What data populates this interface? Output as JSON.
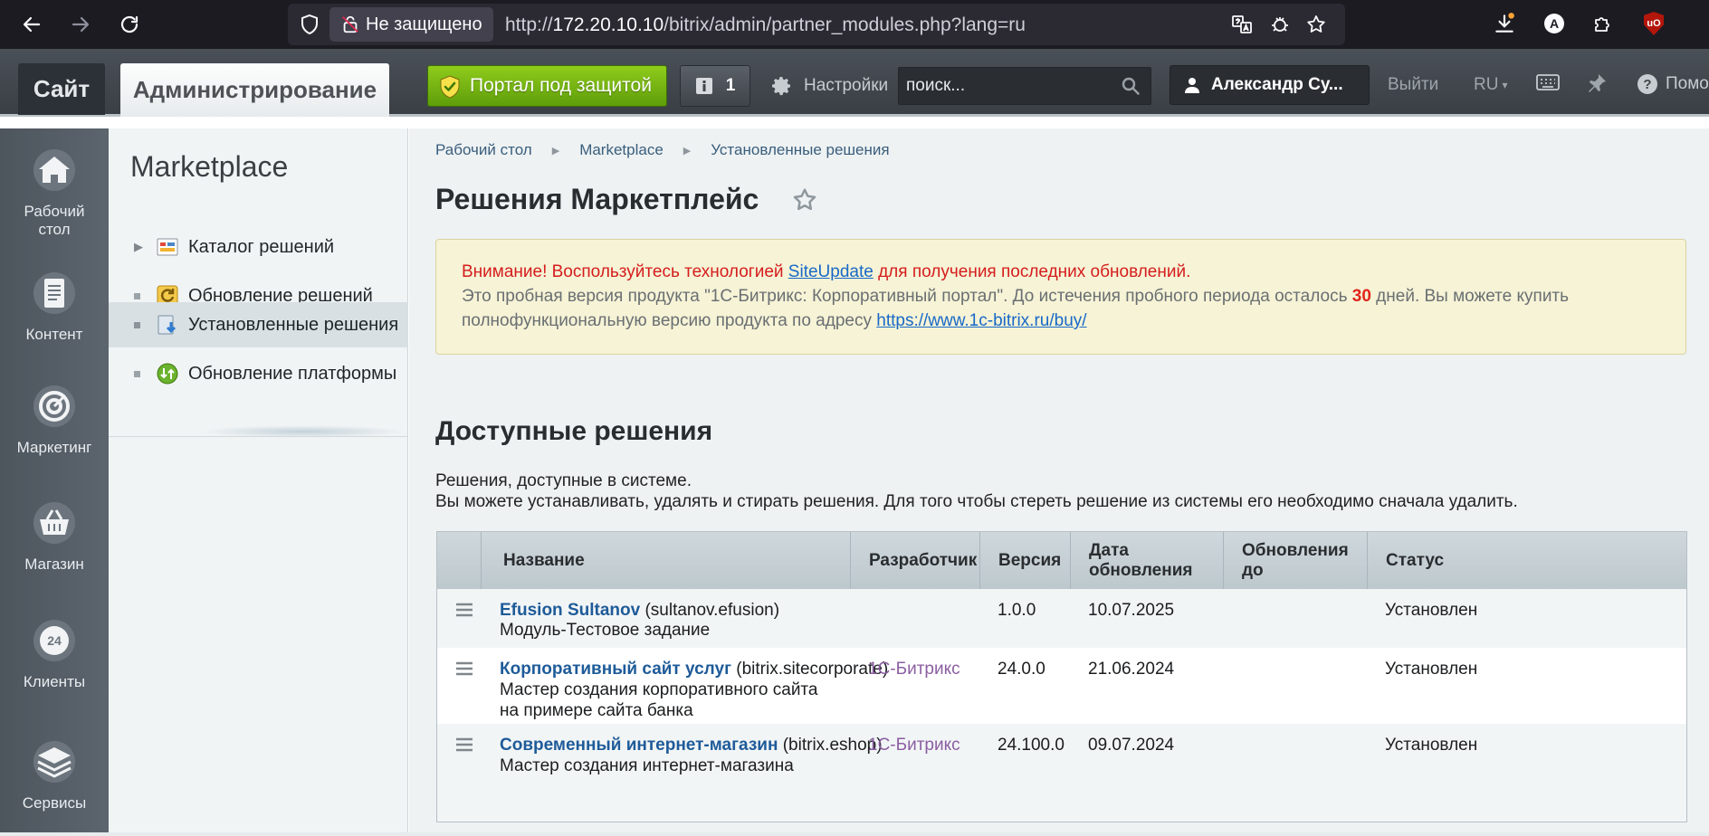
{
  "browser": {
    "security_label": "Не защищено",
    "url_prefix": "http://",
    "url_host": "172.20.10.10",
    "url_path": "/bitrix/admin/partner_modules.php?lang=ru",
    "ext_avatar_letter": "A",
    "ext_ublock_label": "uO"
  },
  "panel": {
    "tab_site": "Сайт",
    "tab_admin": "Администрирование",
    "protected_label": "Портал под защитой",
    "notify_count": "1",
    "settings_label": "Настройки",
    "search_placeholder": "поиск...",
    "user_name": "Александр Су...",
    "logout_label": "Выйти",
    "lang_label": "RU",
    "lang_caret": "▾",
    "help_label": "Помо"
  },
  "left_menu": [
    {
      "label_line1": "Рабочий",
      "label_line2": "стол",
      "icon": "home-icon"
    },
    {
      "label_line1": "Контент",
      "label_line2": "",
      "icon": "document-icon"
    },
    {
      "label_line1": "Маркетинг",
      "label_line2": "",
      "icon": "target-icon"
    },
    {
      "label_line1": "Магазин",
      "label_line2": "",
      "icon": "basket-icon"
    },
    {
      "label_line1": "Клиенты",
      "label_line2": "",
      "icon": "clients-24-icon"
    },
    {
      "label_line1": "Сервисы",
      "label_line2": "",
      "icon": "layers-icon"
    }
  ],
  "clients_badge": "24",
  "sub_menu": {
    "title": "Marketplace",
    "items": [
      {
        "label": "Каталог решений",
        "marker": "▶",
        "icon": "catalog-icon",
        "active": false
      },
      {
        "label": "Обновление решений",
        "marker": "■",
        "icon": "update-solutions-icon",
        "active": false
      },
      {
        "label": "Установленные решения",
        "marker": "■",
        "icon": "installed-icon",
        "active": true
      },
      {
        "label": "Обновление платформы",
        "marker": "■",
        "icon": "platform-update-icon",
        "active": false
      }
    ]
  },
  "breadcrumbs": [
    "Рабочий стол",
    "Marketplace",
    "Установленные решения"
  ],
  "breadcrumb_sep": "▶",
  "page_title": "Решения Маркетплейс",
  "notice": {
    "warn_before": "Внимание! Воспользуйтесь технологией ",
    "warn_link": "SiteUpdate",
    "warn_after": " для получения последних обновлений.",
    "trial_before": "Это пробная версия продукта \"1С-Битрикс: Корпоративный портал\". До истечения пробного периода осталось ",
    "trial_days": "30",
    "trial_after": " дней. Вы можете купить полнофункциональную версию продукта по адресу ",
    "buy_link": "https://www.1c-bitrix.ru/buy/"
  },
  "section": {
    "title": "Доступные решения",
    "desc_line1": "Решения, доступные в системе.",
    "desc_line2": "Вы можете устанавливать, удалять и стирать решения. Для того чтобы стереть решение из системы его необходимо сначала удалить."
  },
  "table": {
    "columns": [
      "Название",
      "Разработчик",
      "Версия",
      "Дата обновления",
      "Обновления до",
      "Статус"
    ],
    "columns_wrapped": {
      "date_1": "Дата",
      "date_2": "обновления",
      "upd_1": "Обновления",
      "upd_2": "до"
    },
    "rows": [
      {
        "name": "Efusion Sultanov",
        "code": " (sultanov.efusion)",
        "desc": "Модуль-Тестовое задание",
        "developer": "",
        "version": "1.0.0",
        "date": "10.07.2025",
        "updates_until": "",
        "status": "Установлен"
      },
      {
        "name": "Корпоративный сайт услуг",
        "code": " (bitrix.sitecorporate)",
        "desc": "Мастер создания корпоративного сайта на примере сайта банка",
        "developer": "1С-Битрикс",
        "version": "24.0.0",
        "date": "21.06.2024",
        "updates_until": "",
        "status": "Установлен"
      },
      {
        "name": "Современный интернет-магазин",
        "code": " (bitrix.eshop)",
        "desc": "Мастер создания интернет-магазина",
        "developer": "1С-Битрикс",
        "version": "24.100.0",
        "date": "09.07.2024",
        "updates_until": "",
        "status": "Установлен"
      }
    ]
  },
  "colors": {
    "accent_link": "#1e5b99",
    "warning_red": "#d51d1d",
    "protected_green": "#6fb012",
    "developer_purple": "#8b5ea1"
  }
}
